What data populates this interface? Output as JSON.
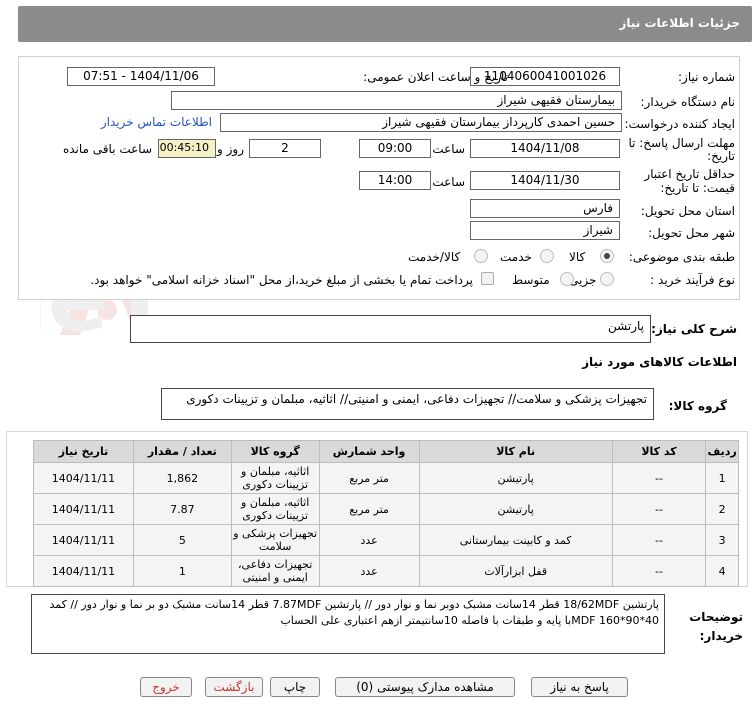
{
  "header": {
    "title": "جزئیات اطلاعات نیاز"
  },
  "form": {
    "need_number_label": "شماره نیاز:",
    "need_number": "1104060041001026",
    "announce_label": "تاریخ و ساعت اعلان عمومی:",
    "announce_value": "1404/11/06 - 07:51",
    "buyer_org_label": "نام دستگاه خریدار:",
    "buyer_org": "بیمارستان فقیهی شیراز",
    "creator_label": "ایجاد کننده درخواست:",
    "creator": "حسین احمدی کارپرداز بیمارستان فقیهی شیراز",
    "contact_link": "اطلاعات تماس خریدار",
    "deadline_label_1": "مهلت ارسال پاسخ: تا",
    "deadline_label_2": "تاریخ:",
    "deadline_date": "1404/11/08",
    "time_label": "ساعت",
    "deadline_time": "09:00",
    "days_value": "2",
    "days_label": "روز و",
    "remaining_time": "00:45:10",
    "remaining_label": "ساعت باقی مانده",
    "validity_label_1": "حداقل تاریخ اعتبار",
    "validity_label_2": "قیمت: تا تاریخ:",
    "validity_date": "1404/11/30",
    "validity_time": "14:00",
    "province_label": "استان محل تحویل:",
    "province": "فارس",
    "city_label": "شهر محل تحویل:",
    "city": "شیراز",
    "category_label": "طبقه بندی موضوعی:",
    "category_options": [
      "کالا",
      "خدمت",
      "کالا/خدمت"
    ],
    "category_selected": "کالا",
    "process_label": "نوع فرآیند خرید :",
    "process_options": [
      "جزیی",
      "متوسط"
    ],
    "process_note": "پرداخت تمام یا بخشی از مبلغ خرید،از محل \"اسناد خزانه اسلامی\" خواهد بود."
  },
  "summary": {
    "label": "شرح کلی نیاز:",
    "value": "پارتشن"
  },
  "goods_info_title": "اطلاعات کالاهای مورد نیاز",
  "goods_group": {
    "label": "گروه کالا:",
    "value": "تجهیزات پزشکی و سلامت// تجهیزات دفاعی، ایمنی و امنیتی// اثاثیه، مبلمان و تزیینات دکوری"
  },
  "table": {
    "headers": [
      "ردیف",
      "کد کالا",
      "نام کالا",
      "واحد شمارش",
      "گروه کالا",
      "تعداد / مقدار",
      "تاریخ نیاز"
    ],
    "rows": [
      [
        "1",
        "--",
        "پارتیشن",
        "متر مربع",
        "اثاثیه، مبلمان و تزیینات دکوری",
        "1,862",
        "1404/11/11"
      ],
      [
        "2",
        "--",
        "پارتیشن",
        "متر مربع",
        "اثاثیه، مبلمان و تزیینات دکوری",
        "7.87",
        "1404/11/11"
      ],
      [
        "3",
        "--",
        "کمد و کابینت بیمارستانی",
        "عدد",
        "تجهیزات پزشکی و سلامت",
        "5",
        "1404/11/11"
      ],
      [
        "4",
        "--",
        "قفل ابزارآلات",
        "عدد",
        "تجهیزات دفاعی، ایمنی و امنیتی",
        "1",
        "1404/11/11"
      ]
    ]
  },
  "buyer_notes": {
    "label_1": "توضیحات",
    "label_2": "خریدار:",
    "text": "پارتشین 18/62MDF     قطر 14سانت مشبک دوبر نما    و نوار دور    //  پارتشین 7.87MDF     قطر 14سانت مشبک دو بر نما    و نوار دور  //  کمد 40*90*160 MDFبا پایه و طبقات با فاصله  10سانتیمتر ازهم  اعتباری علی الحساب"
  },
  "buttons": {
    "reply": "پاسخ به نیاز",
    "docs": "مشاهده مدارک پیوستی (0)",
    "print": "چاپ",
    "back": "بازگشت",
    "exit": "خروج"
  },
  "watermark_text": "AriaTender.neT",
  "colors": {
    "title_bg": "#8b8b8b",
    "link": "#1f57c4",
    "yellow_field": "#f7f1c8",
    "exit_text": "#c0392b"
  }
}
